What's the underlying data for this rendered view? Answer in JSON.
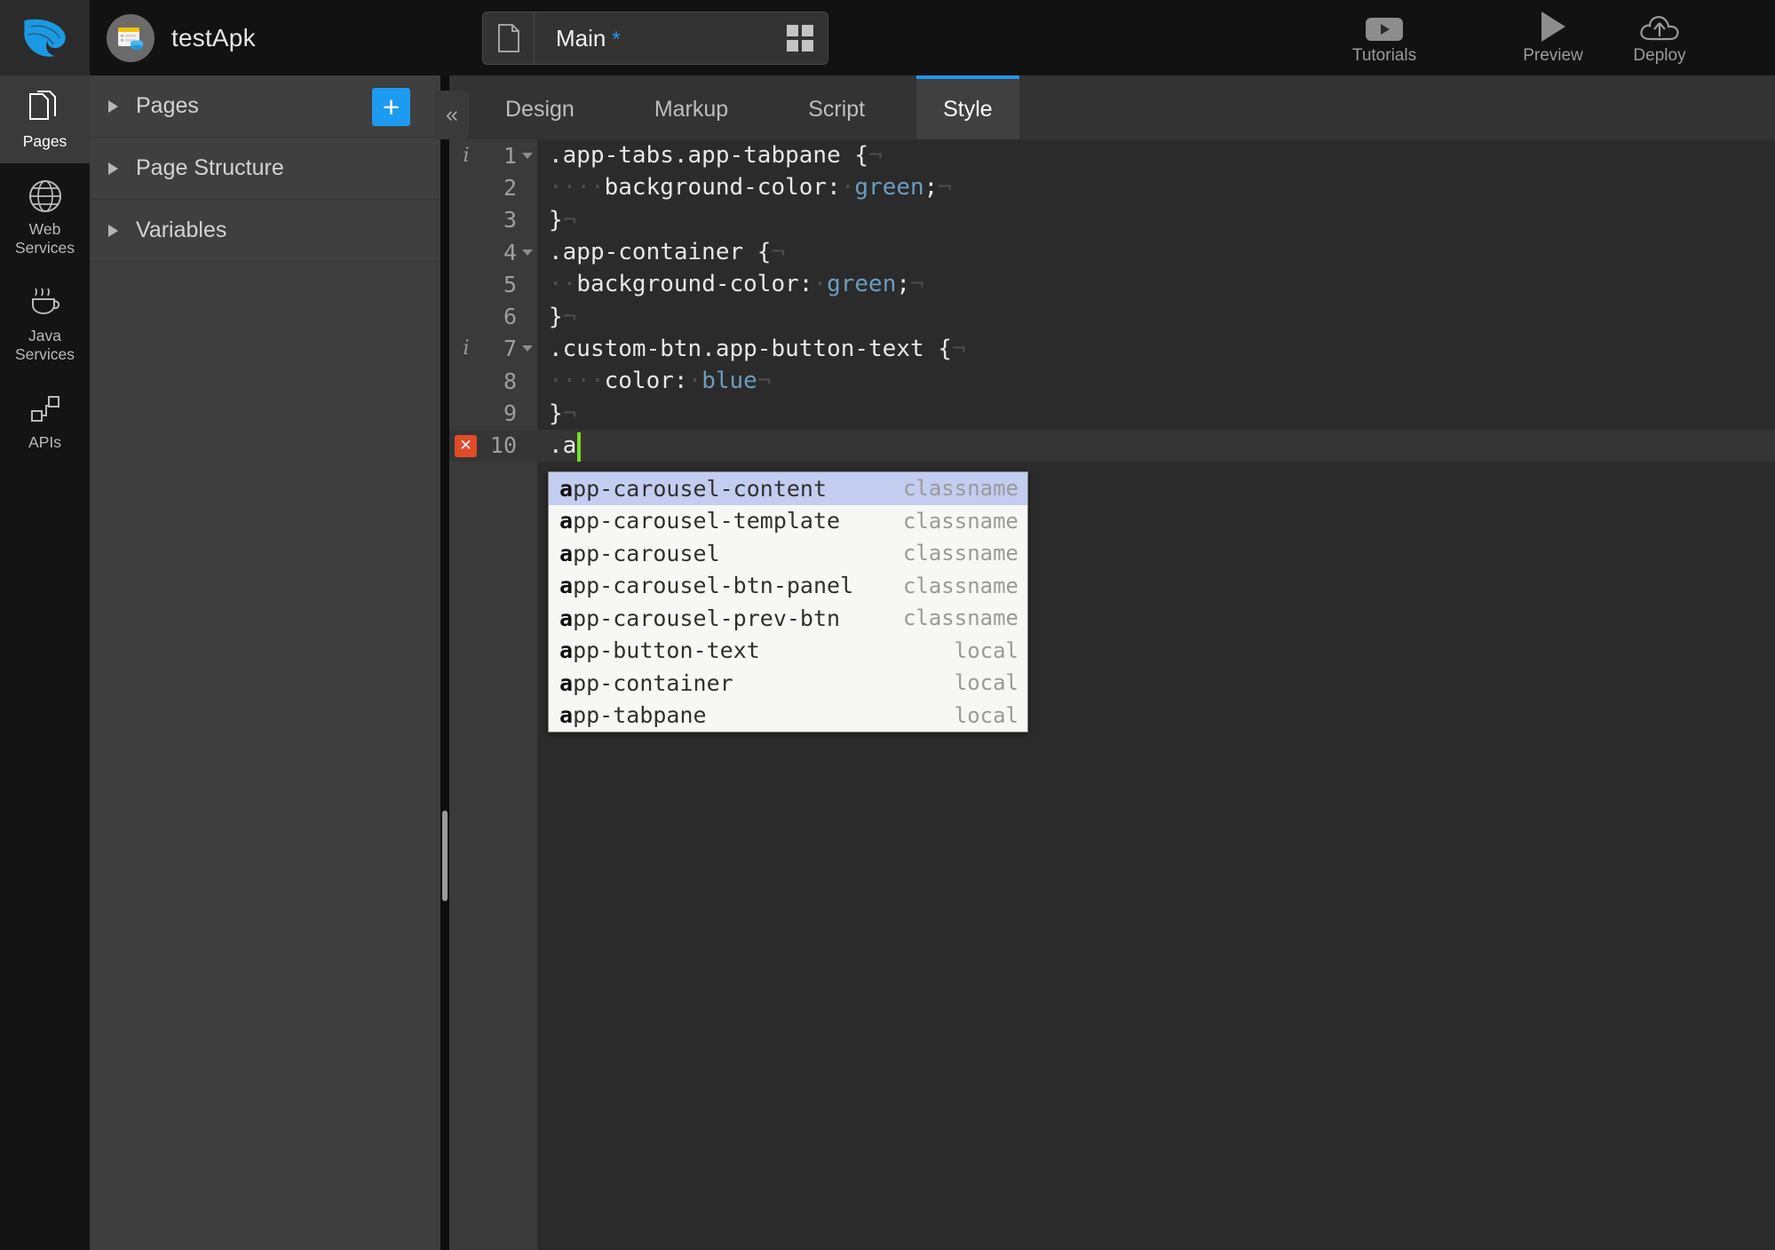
{
  "topbar": {
    "logo_icon": "wave-logo-icon",
    "project_avatar_icon": "project-app-icon",
    "project_name": "testApk",
    "file_tab": {
      "file_icon": "document-icon",
      "label": "Main",
      "dirty_marker": "*",
      "grid_icon": "grid-view-icon"
    },
    "actions": [
      {
        "label": "Tutorials",
        "icon": "youtube-play-icon"
      },
      {
        "label": "Preview",
        "icon": "play-triangle-icon"
      },
      {
        "label": "Deploy",
        "icon": "cloud-upload-icon"
      }
    ]
  },
  "rail": {
    "items": [
      {
        "label": "Pages",
        "icon": "pages-icon",
        "active": true
      },
      {
        "label": "Web\nServices",
        "label_line1": "Web",
        "label_line2": "Services",
        "icon": "globe-icon",
        "active": false
      },
      {
        "label": "Java\nServices",
        "label_line1": "Java",
        "label_line2": "Services",
        "icon": "coffee-cup-icon",
        "active": false
      },
      {
        "label": "APIs",
        "icon": "api-nodes-icon",
        "active": false
      }
    ]
  },
  "left_panel": {
    "sections": [
      {
        "label": "Pages",
        "caret": "collapsed"
      },
      {
        "label": "Page Structure",
        "caret": "collapsed"
      },
      {
        "label": "Variables",
        "caret": "collapsed"
      }
    ],
    "add_button_label": "+",
    "collapse_button_label": "«"
  },
  "editor": {
    "tabs": [
      {
        "label": "Design",
        "active": false
      },
      {
        "label": "Markup",
        "active": false
      },
      {
        "label": "Script",
        "active": false
      },
      {
        "label": "Style",
        "active": true
      }
    ],
    "active_tab_accent": "#2196f3",
    "lines": [
      {
        "num": "1",
        "info": true,
        "fold": true,
        "error": false,
        "current": false,
        "text": ".app-tabs.app-tabpane {",
        "kind": "selector"
      },
      {
        "num": "2",
        "info": false,
        "fold": false,
        "error": false,
        "current": false,
        "text": "    background-color: green;",
        "kind": "decl",
        "prop": "background-color",
        "value": "green"
      },
      {
        "num": "3",
        "info": false,
        "fold": false,
        "error": false,
        "current": false,
        "text": "}",
        "kind": "close"
      },
      {
        "num": "4",
        "info": false,
        "fold": true,
        "error": false,
        "current": false,
        "text": ".app-container {",
        "kind": "selector"
      },
      {
        "num": "5",
        "info": false,
        "fold": false,
        "error": false,
        "current": false,
        "text": "  background-color: green;",
        "kind": "decl",
        "prop": "background-color",
        "value": "green"
      },
      {
        "num": "6",
        "info": false,
        "fold": false,
        "error": false,
        "current": false,
        "text": "}",
        "kind": "close"
      },
      {
        "num": "7",
        "info": true,
        "fold": true,
        "error": false,
        "current": false,
        "text": ".custom-btn.app-button-text {",
        "kind": "selector"
      },
      {
        "num": "8",
        "info": false,
        "fold": false,
        "error": false,
        "current": false,
        "text": "    color: blue",
        "kind": "decl",
        "prop": "color",
        "value": "blue"
      },
      {
        "num": "9",
        "info": false,
        "fold": false,
        "error": false,
        "current": false,
        "text": "}",
        "kind": "close"
      },
      {
        "num": "10",
        "info": false,
        "fold": false,
        "error": true,
        "current": true,
        "text": ".a",
        "kind": "typing"
      }
    ],
    "error_marker_glyph": "✕",
    "error_marker_color": "#e04b2a",
    "info_marker_glyph": "i",
    "caret_color": "#76e023"
  },
  "autocomplete": {
    "typed_prefix": "a",
    "items": [
      {
        "prefix": "a",
        "rest": "pp-carousel-content",
        "kind": "classname",
        "selected": true
      },
      {
        "prefix": "a",
        "rest": "pp-carousel-template",
        "kind": "classname",
        "selected": false
      },
      {
        "prefix": "a",
        "rest": "pp-carousel",
        "kind": "classname",
        "selected": false
      },
      {
        "prefix": "a",
        "rest": "pp-carousel-btn-panel",
        "kind": "classname",
        "selected": false
      },
      {
        "prefix": "a",
        "rest": "pp-carousel-prev-btn",
        "kind": "classname",
        "selected": false
      },
      {
        "prefix": "a",
        "rest": "pp-button-text",
        "kind": "local",
        "selected": false
      },
      {
        "prefix": "a",
        "rest": "pp-container",
        "kind": "local",
        "selected": false
      },
      {
        "prefix": "a",
        "rest": "pp-tabpane",
        "kind": "local",
        "selected": false
      }
    ],
    "selected_background": "#c3cdf0"
  },
  "colors": {
    "accent_blue": "#1d9bf0",
    "tab_accent": "#2196f3",
    "code_value": "#6d9cbe",
    "error_red": "#e04b2a",
    "caret_green": "#76e023",
    "editor_bg": "#2b2b2b",
    "panel_bg": "#3f3f3f",
    "rail_bg": "#141414"
  }
}
